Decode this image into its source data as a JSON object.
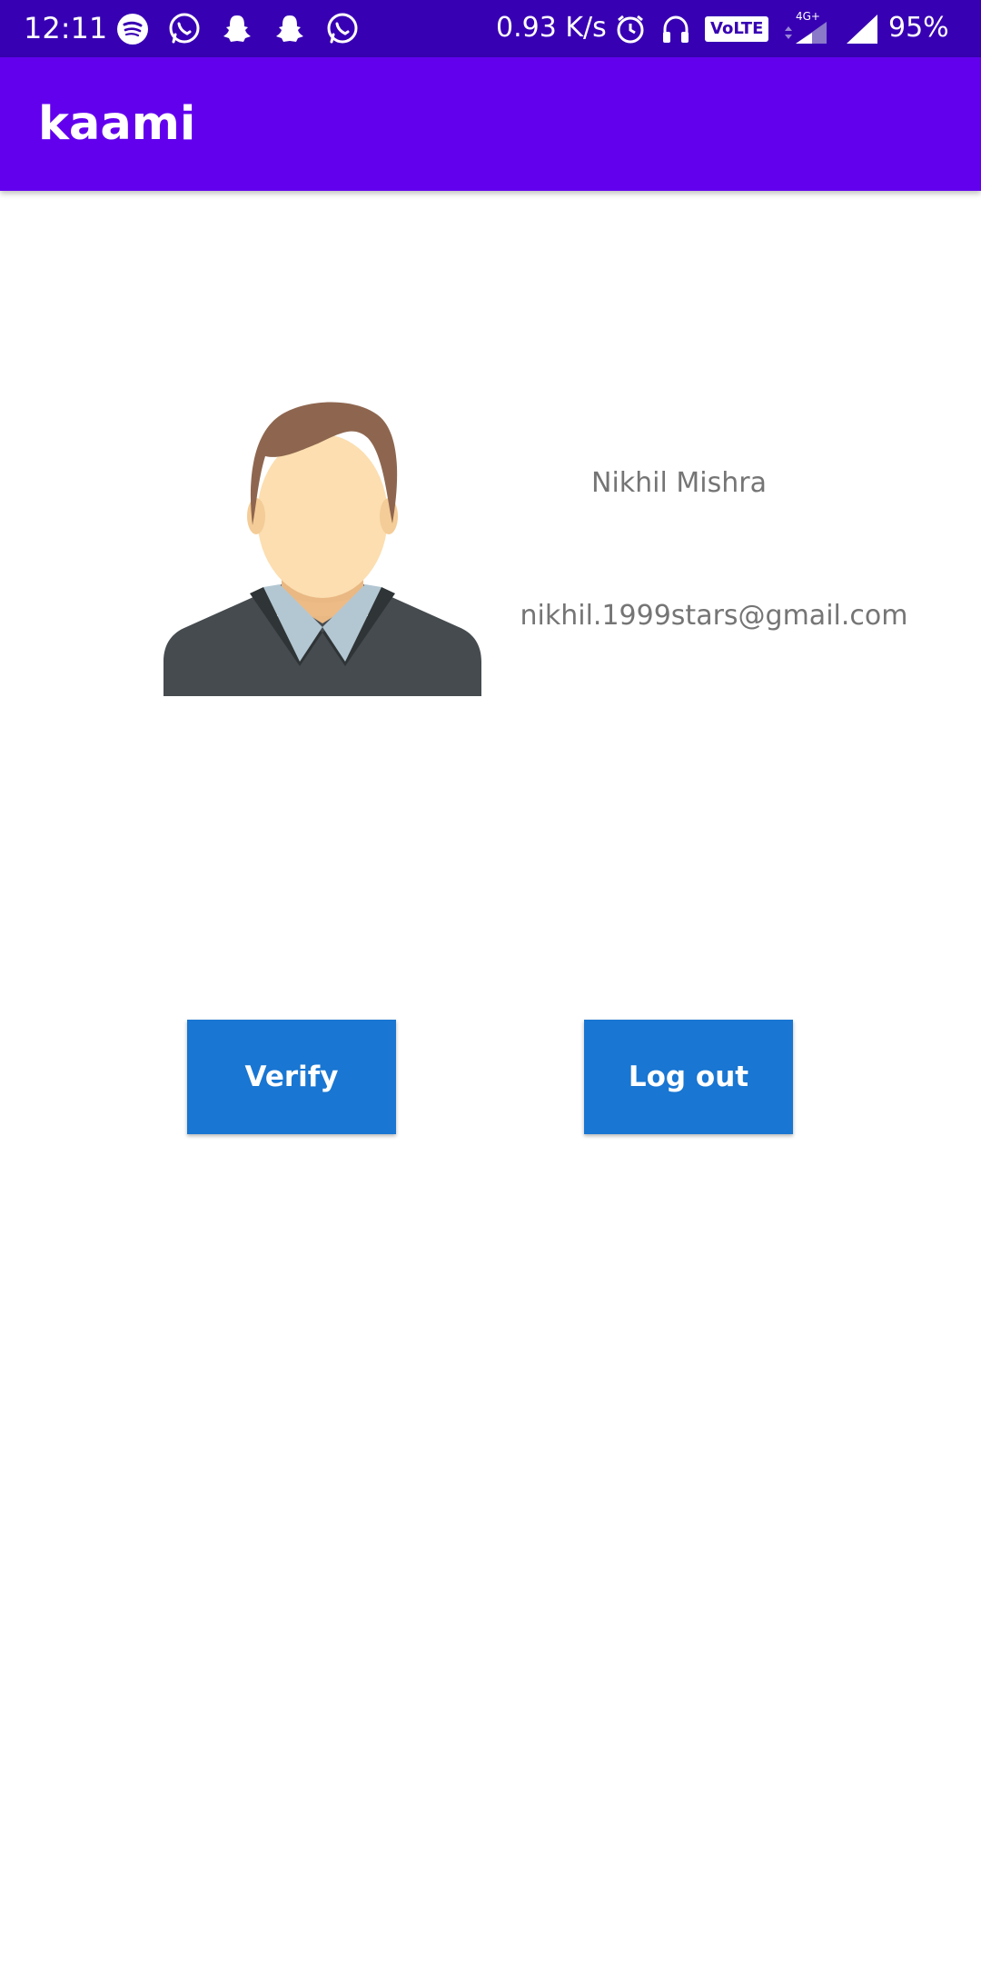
{
  "status_bar": {
    "time": "12:11",
    "network_speed": "0.93 K/s",
    "volte_label": "VoLTE",
    "network_type": "4G+",
    "battery": "95%",
    "notification_icons": [
      "spotify-icon",
      "whatsapp-icon",
      "snapchat-icon",
      "snapchat-icon",
      "whatsapp-icon"
    ],
    "system_icons": [
      "alarm-icon",
      "headphones-icon",
      "volte-badge",
      "signal-4g-icon",
      "signal-icon"
    ]
  },
  "app_bar": {
    "title": "kaami"
  },
  "profile": {
    "name": "Nikhil Mishra",
    "email": "nikhil.1999stars@gmail.com",
    "avatar_icon": "male-avatar-icon"
  },
  "actions": {
    "verify_label": "Verify",
    "logout_label": "Log out"
  },
  "colors": {
    "status_bar": "#3700b3",
    "app_bar": "#6200ee",
    "button": "#1976d2",
    "secondary_text": "#757575"
  }
}
